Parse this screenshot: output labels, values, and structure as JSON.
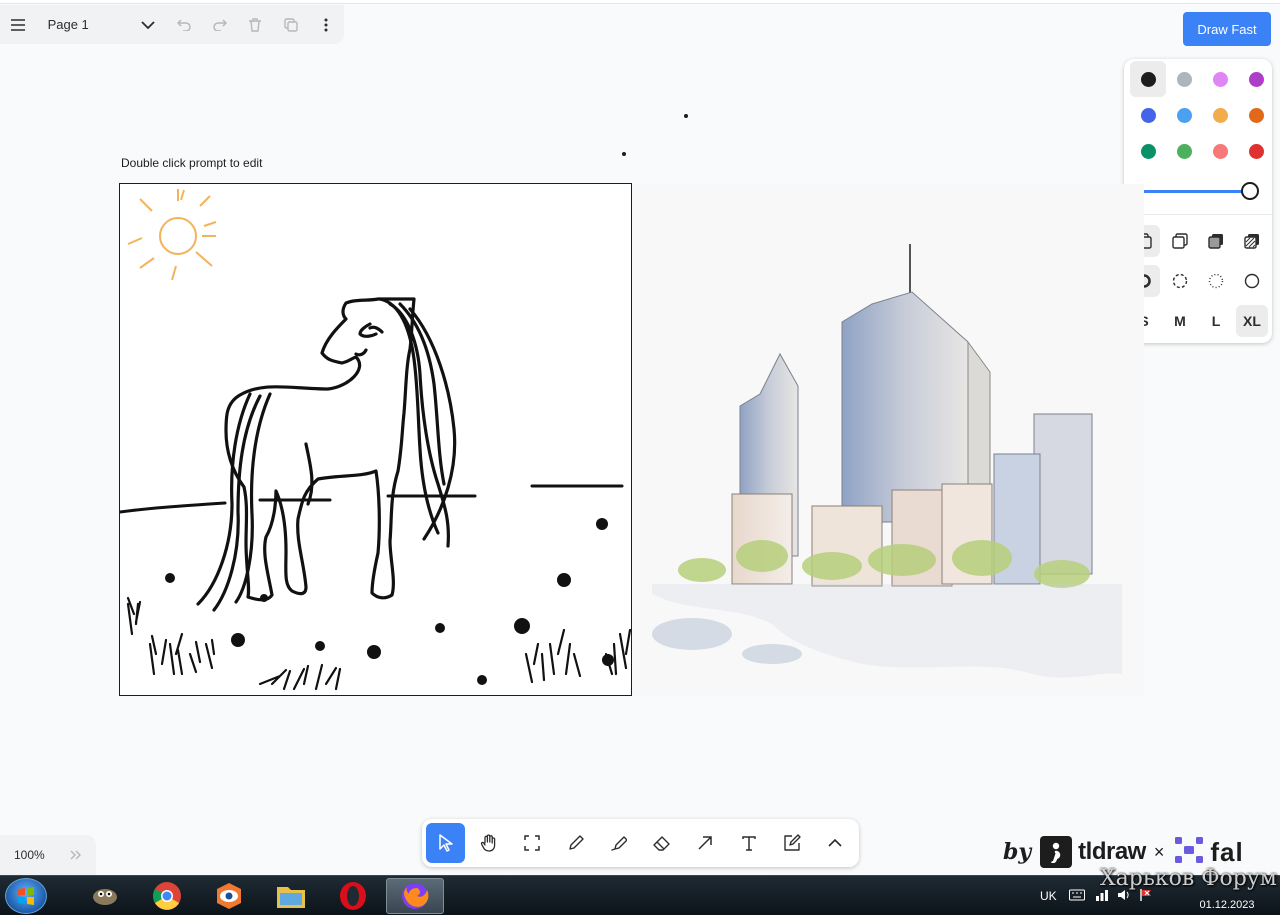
{
  "menu": {
    "page_name": "Page 1",
    "icons": [
      "hamburger-menu-icon",
      "chevron-down-icon",
      "undo-icon",
      "redo-icon",
      "trash-icon",
      "duplicate-icon",
      "more-vertical-icon"
    ]
  },
  "draw_fast_label": "Draw Fast",
  "style_panel": {
    "colors": [
      "#1d1d1d",
      "#adb5bd",
      "#e085f4",
      "#ae3ec9",
      "#4465e9",
      "#4ba1f1",
      "#f1ac4b",
      "#e16919",
      "#099268",
      "#4cb05e",
      "#f87777",
      "#e03131"
    ],
    "selected_color_index": 0,
    "opacity": 1,
    "fill_options": [
      "fill-none-icon",
      "fill-semi-icon",
      "fill-solid-icon",
      "fill-pattern-icon"
    ],
    "dash_options": [
      "dash-draw-icon",
      "dash-dashed-icon",
      "dash-dotted-icon",
      "dash-solid-icon"
    ],
    "sizes": [
      "S",
      "M",
      "L",
      "XL"
    ],
    "selected_size": "XL"
  },
  "canvas": {
    "prompt_label": "Double click prompt to edit"
  },
  "zoom": {
    "value": "100%"
  },
  "toolbar": {
    "tools": [
      "select-icon",
      "hand-icon",
      "frame-icon",
      "draw-icon",
      "highlight-icon",
      "eraser-icon",
      "arrow-icon",
      "text-icon",
      "note-icon",
      "chevron-up-icon"
    ],
    "active_tool": "select-icon"
  },
  "branding": {
    "by": "by",
    "tldraw": "tldraw",
    "x": "×",
    "fal": "fal"
  },
  "taskbar": {
    "apps": [
      "gimp-icon",
      "chrome-icon",
      "eye-app-icon",
      "file-explorer-icon",
      "opera-icon",
      "firefox-icon"
    ],
    "active_app": "firefox-icon",
    "language": "UK",
    "date": "01.12.2023"
  },
  "watermark": "Харьков Форум"
}
